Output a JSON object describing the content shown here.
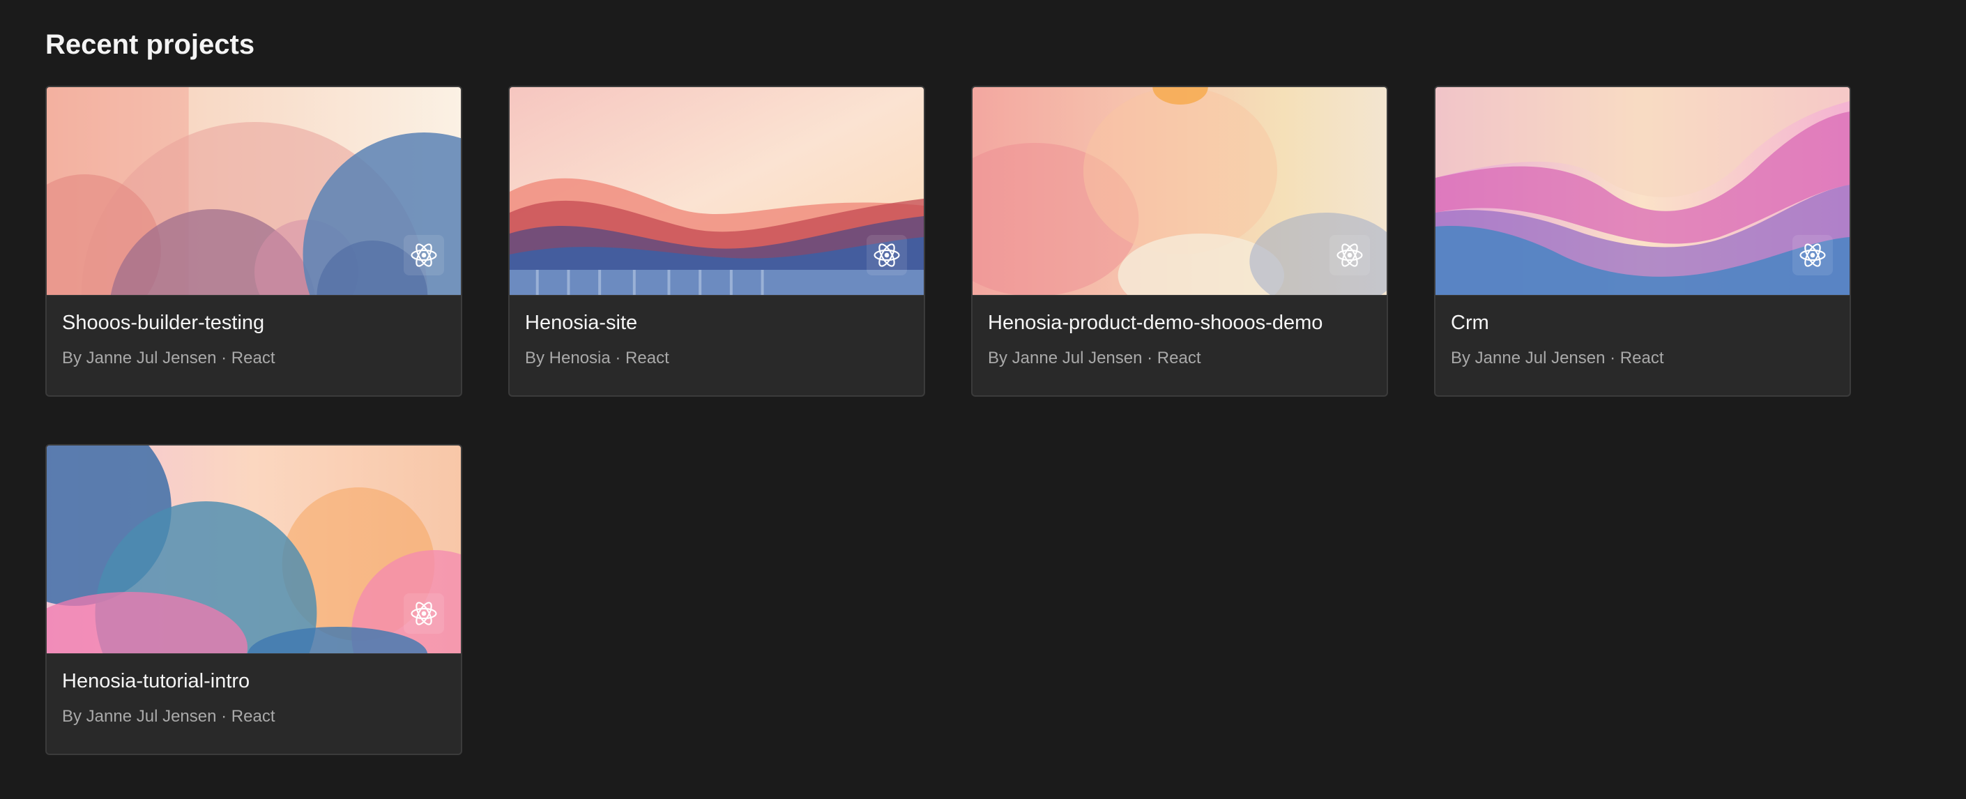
{
  "section": {
    "title": "Recent projects"
  },
  "projects": [
    {
      "name": "Shooos-builder-testing",
      "meta": "By Janne Jul Jensen · React",
      "framework_icon": "react-icon"
    },
    {
      "name": "Henosia-site",
      "meta": "By Henosia · React",
      "framework_icon": "react-icon"
    },
    {
      "name": "Henosia-product-demo-shooos-demo",
      "meta": "By Janne Jul Jensen · React",
      "framework_icon": "react-icon"
    },
    {
      "name": "Crm",
      "meta": "By Janne Jul Jensen · React",
      "framework_icon": "react-icon"
    },
    {
      "name": "Henosia-tutorial-intro",
      "meta": "By Janne Jul Jensen · React",
      "framework_icon": "react-icon"
    }
  ],
  "colors": {
    "background": "#1b1b1b",
    "card": "#292929",
    "card_border": "#3b3b3b",
    "title_text": "#f5f5f5",
    "meta_text": "#a9a9a9"
  }
}
